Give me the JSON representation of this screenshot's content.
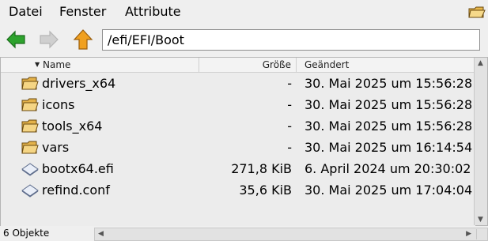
{
  "menubar": {
    "items": [
      "Datei",
      "Fenster",
      "Attribute"
    ]
  },
  "toolbar": {
    "back_icon": "arrow-left-icon",
    "forward_icon": "arrow-right-icon",
    "up_icon": "arrow-up-icon",
    "path": "/efi/EFI/Boot"
  },
  "columns": {
    "name": "Name",
    "size": "Größe",
    "modified": "Geändert",
    "sort": "Name"
  },
  "rows": [
    {
      "name": "drivers_x64",
      "size": "-",
      "date": "30. Mai 2025 um 15:56:28",
      "type": "folder"
    },
    {
      "name": "icons",
      "size": "-",
      "date": "30. Mai 2025 um 15:56:28",
      "type": "folder"
    },
    {
      "name": "tools_x64",
      "size": "-",
      "date": "30. Mai 2025 um 15:56:28",
      "type": "folder"
    },
    {
      "name": "vars",
      "size": "-",
      "date": "30. Mai 2025 um 16:14:54",
      "type": "folder"
    },
    {
      "name": "bootx64.efi",
      "size": "271,8 KiB",
      "date": "6. April 2024 um 20:30:02",
      "type": "file"
    },
    {
      "name": "refind.conf",
      "size": "35,6 KiB",
      "date": "30. Mai 2025 um 17:04:04",
      "type": "file"
    }
  ],
  "status": {
    "count": "6 Objekte"
  },
  "colors": {
    "arrow_green": "#2da32d",
    "arrow_orange": "#f0a020",
    "folder": "#e6b34a"
  }
}
